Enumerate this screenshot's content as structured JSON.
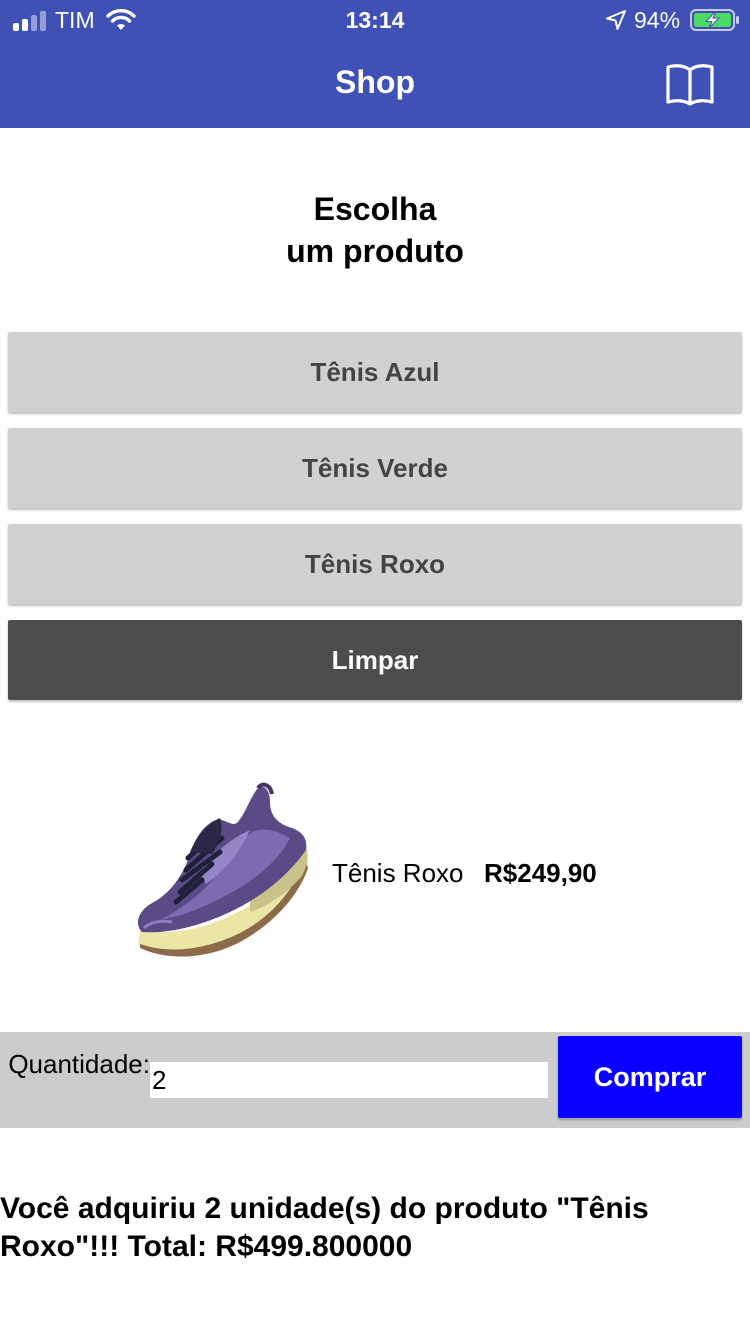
{
  "status_bar": {
    "carrier": "TIM",
    "time": "13:14",
    "battery_percent": "94%",
    "icons": [
      "signal-icon",
      "wifi-icon",
      "location-arrow-icon",
      "battery-charging-icon"
    ]
  },
  "nav": {
    "title": "Shop",
    "right_icon": "book-icon"
  },
  "heading": {
    "line1": "Escolha",
    "line2": "um produto"
  },
  "product_buttons": [
    {
      "label": "Tênis Azul"
    },
    {
      "label": "Tênis Verde"
    },
    {
      "label": "Tênis Roxo"
    }
  ],
  "clear_button": {
    "label": "Limpar"
  },
  "selected_product": {
    "image_icon": "purple-sneaker-image",
    "name": "Tênis Roxo",
    "price": "R$249,90"
  },
  "purchase": {
    "quantity_label": "Quantidade:",
    "quantity_value": "2",
    "buy_label": "Comprar"
  },
  "result_message": "Você adquiriu 2 unidade(s) do produto \"Tênis Roxo\"!!! Total: R$499.800000",
  "colors": {
    "nav_bg": "#3f51b5",
    "button_bg": "#d1d1d1",
    "clear_bg": "#4c4c4c",
    "buy_bg": "#0c00ff",
    "buybar_bg": "#cccccc"
  }
}
